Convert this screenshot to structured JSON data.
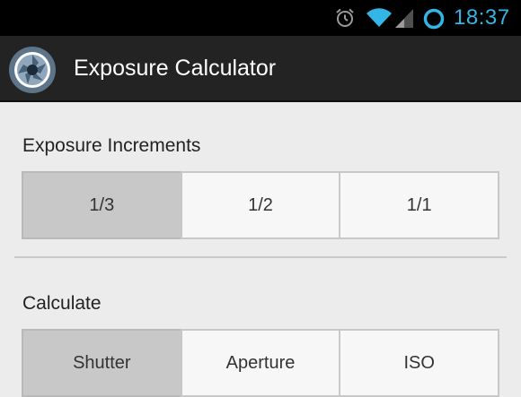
{
  "status_bar": {
    "time": "18:37",
    "icons": [
      "alarm-icon",
      "wifi-icon",
      "signal-icon",
      "sync-icon"
    ],
    "accent_color": "#33b5e5"
  },
  "action_bar": {
    "title": "Exposure Calculator",
    "logo_icon": "aperture-icon"
  },
  "exposure_increments": {
    "title": "Exposure Increments",
    "options": [
      "1/3",
      "1/2",
      "1/1"
    ],
    "selected": "1/3"
  },
  "calculate": {
    "title": "Calculate",
    "options": [
      "Shutter",
      "Aperture",
      "ISO"
    ],
    "selected": "Shutter"
  },
  "colors": {
    "background": "#ececec",
    "action_bar": "#232323",
    "selected_segment": "#c8c8c8"
  }
}
